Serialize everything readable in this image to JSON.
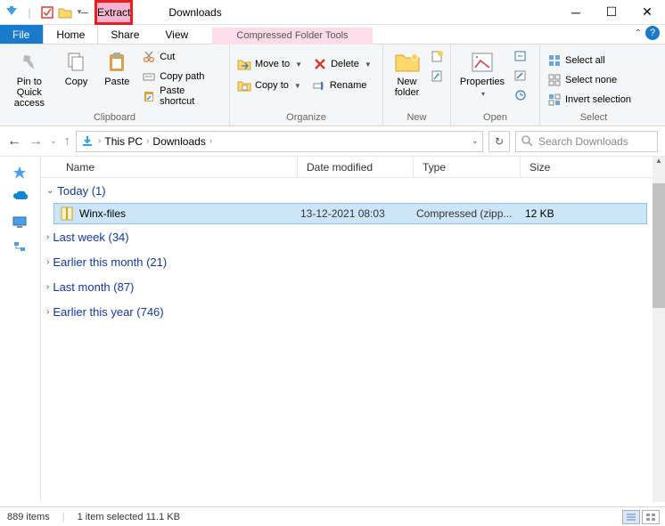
{
  "titlebar": {
    "context_tab": "Extract",
    "context_sub": "Compressed Folder Tools",
    "title": "Downloads"
  },
  "tabs": {
    "file": "File",
    "home": "Home",
    "share": "Share",
    "view": "View"
  },
  "ribbon": {
    "clipboard": {
      "pin": "Pin to Quick access",
      "copy": "Copy",
      "paste": "Paste",
      "cut": "Cut",
      "copy_path": "Copy path",
      "paste_shortcut": "Paste shortcut",
      "label": "Clipboard"
    },
    "organize": {
      "move": "Move to",
      "copy": "Copy to",
      "delete": "Delete",
      "rename": "Rename",
      "label": "Organize"
    },
    "new": {
      "new_folder": "New folder",
      "label": "New"
    },
    "open": {
      "properties": "Properties",
      "label": "Open"
    },
    "select": {
      "all": "Select all",
      "none": "Select none",
      "invert": "Invert selection",
      "label": "Select"
    }
  },
  "nav": {
    "crumbs": [
      "This PC",
      "Downloads"
    ],
    "search_placeholder": "Search Downloads"
  },
  "columns": {
    "name": "Name",
    "date": "Date modified",
    "type": "Type",
    "size": "Size"
  },
  "groups": [
    {
      "label": "Today (1)",
      "expanded": true
    },
    {
      "label": "Last week (34)",
      "expanded": false
    },
    {
      "label": "Earlier this month (21)",
      "expanded": false
    },
    {
      "label": "Last month (87)",
      "expanded": false
    },
    {
      "label": "Earlier this year (746)",
      "expanded": false
    }
  ],
  "file": {
    "name": "Winx-files",
    "date": "13-12-2021 08:03",
    "type": "Compressed (zipp...",
    "size": "12 KB"
  },
  "status": {
    "count": "889 items",
    "selection": "1 item selected  11.1 KB"
  }
}
